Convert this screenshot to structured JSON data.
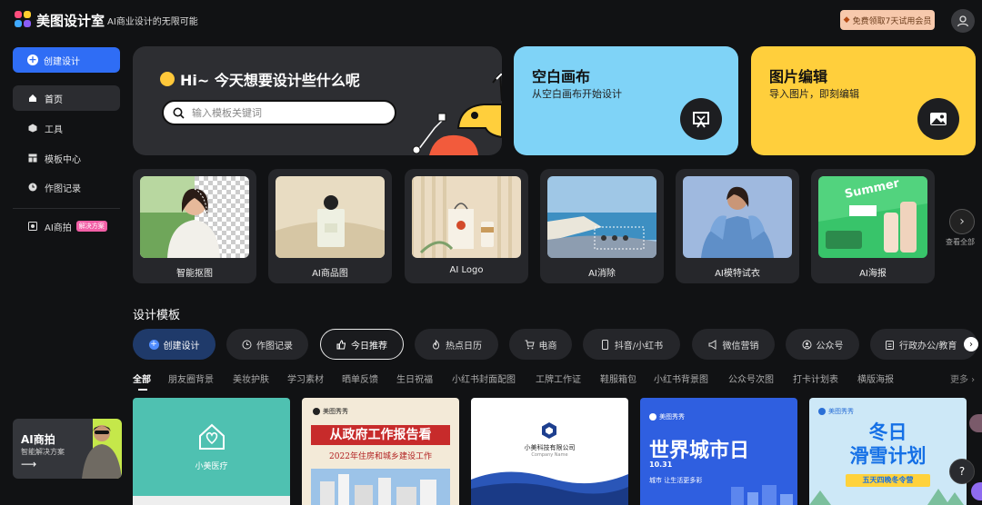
{
  "header": {
    "brand": "美图设计室",
    "slogan": "AI商业设计的无限可能",
    "trial_label": "免费领取7天试用会员"
  },
  "sidebar": {
    "create_label": "创建设计",
    "items": [
      {
        "label": "首页"
      },
      {
        "label": "工具"
      },
      {
        "label": "模板中心"
      },
      {
        "label": "作图记录"
      }
    ],
    "ai_item": {
      "label": "AI商拍",
      "badge": "解决方案"
    },
    "promo": {
      "title": "AI商拍",
      "subtitle": "智能解决方案",
      "arrow": "⟶"
    }
  },
  "hero": {
    "greeting": "Hi~ 今天想要设计些什么呢",
    "search_placeholder": "输入模板关键词"
  },
  "cards": {
    "blank": {
      "title": "空白画布",
      "subtitle": "从空白画布开始设计",
      "color": "#7fd3f7"
    },
    "edit": {
      "title": "图片编辑",
      "subtitle": "导入图片，即刻编辑",
      "color": "#ffcf3c"
    }
  },
  "tools": [
    {
      "label": "智能抠图"
    },
    {
      "label": "AI商品图"
    },
    {
      "label": "AI Logo"
    },
    {
      "label": "AI消除"
    },
    {
      "label": "AI模特试衣"
    },
    {
      "label": "AI海报"
    }
  ],
  "tools_more_label": "查看全部",
  "section_title": "设计模板",
  "pills": [
    {
      "label": "创建设计"
    },
    {
      "label": "作图记录"
    },
    {
      "label": "今日推荐"
    },
    {
      "label": "热点日历"
    },
    {
      "label": "电商"
    },
    {
      "label": "抖音/小红书"
    },
    {
      "label": "微信营销"
    },
    {
      "label": "公众号"
    },
    {
      "label": "行政办公/教育"
    }
  ],
  "filters": [
    "全部",
    "朋友圈背景",
    "美妆护肤",
    "学习素材",
    "晒单反馈",
    "生日祝福",
    "小红书封面配图",
    "工牌工作证",
    "鞋服箱包",
    "小红书背景图",
    "公众号次图",
    "打卡计划表",
    "横版海报"
  ],
  "filters_more": "更多 ›",
  "templates": {
    "t1": {
      "name": "小美医疗"
    },
    "t2": {
      "brand": "美图秀秀",
      "title": "从政府工作报告看",
      "subtitle": "2022年住房和城乡建设工作"
    },
    "t3": {
      "name": "小美科技有限公司",
      "en": "Company Name"
    },
    "t4": {
      "brand": "美图秀秀",
      "title": "世界城市日",
      "date": "10.31",
      "sub": "城市 让生活更多彩"
    },
    "t5": {
      "brand": "美图秀秀",
      "title1": "冬日",
      "title2": "滑雪计划",
      "ribbon": "五天四晚冬令营"
    }
  },
  "help_label": "?"
}
